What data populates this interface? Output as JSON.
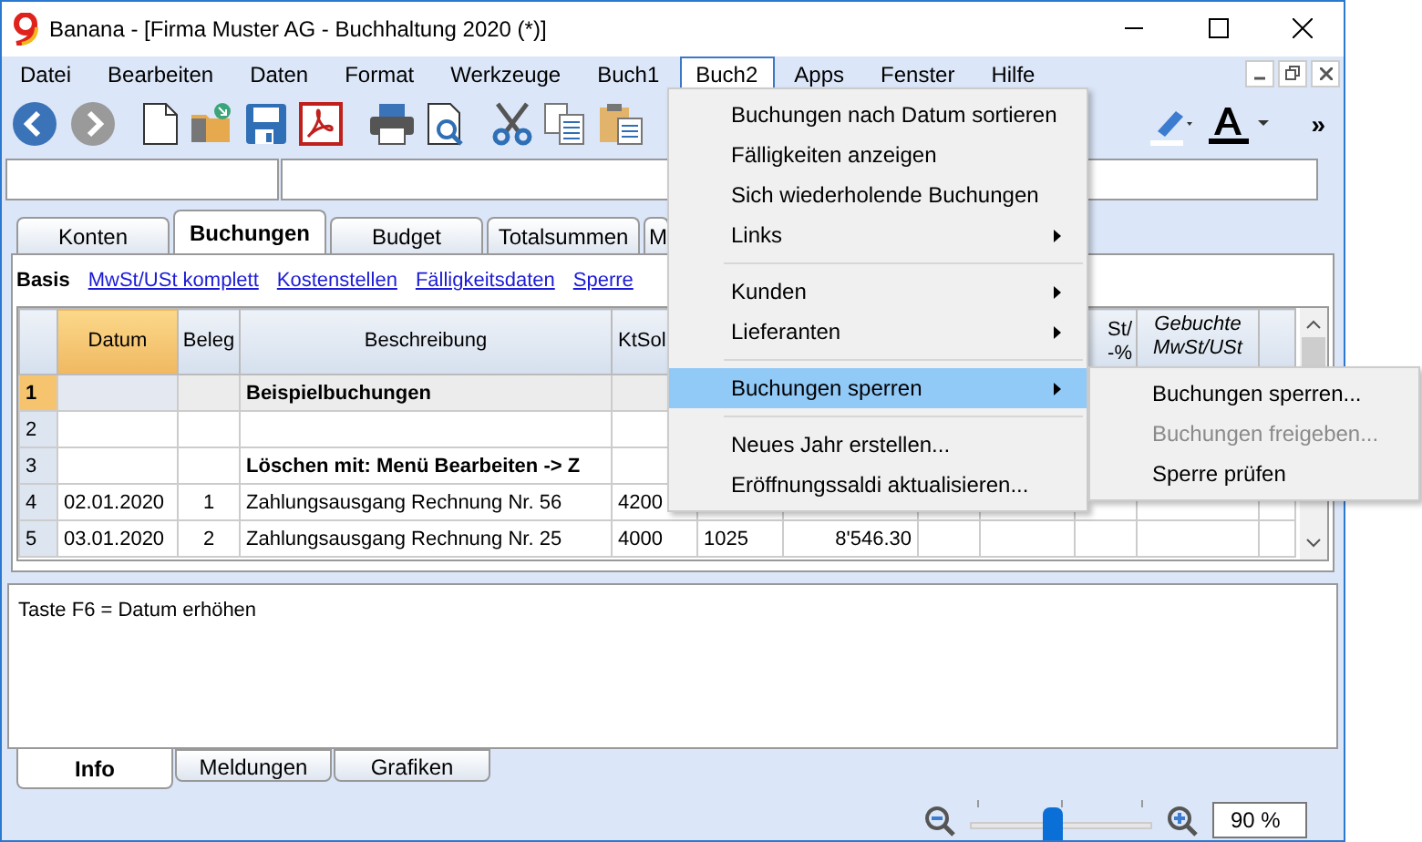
{
  "window": {
    "title": "Banana - [Firma Muster AG - Buchhaltung 2020 (*)]"
  },
  "menu_bar": [
    {
      "label": "Datei",
      "selected": false
    },
    {
      "label": "Bearbeiten",
      "selected": false
    },
    {
      "label": "Daten",
      "selected": false
    },
    {
      "label": "Format",
      "selected": false
    },
    {
      "label": "Werkzeuge",
      "selected": false
    },
    {
      "label": "Buch1",
      "selected": false
    },
    {
      "label": "Buch2",
      "selected": true
    },
    {
      "label": "Apps",
      "selected": false
    },
    {
      "label": "Fenster",
      "selected": false
    },
    {
      "label": "Hilfe",
      "selected": false
    }
  ],
  "toolbar": [
    {
      "kind": "back",
      "disabled": false
    },
    {
      "kind": "forward",
      "disabled": true
    },
    {
      "kind": "new"
    },
    {
      "kind": "open"
    },
    {
      "kind": "save"
    },
    {
      "kind": "pdf"
    },
    {
      "kind": "print"
    },
    {
      "kind": "preview"
    },
    {
      "kind": "cut"
    },
    {
      "kind": "copy"
    },
    {
      "kind": "paste"
    }
  ],
  "toolbar_overflow": "»",
  "tabs": [
    {
      "label": "Konten",
      "selected": false
    },
    {
      "label": "Buchungen",
      "selected": true
    },
    {
      "label": "Budget",
      "selected": false
    },
    {
      "label": "Totalsummen",
      "selected": false
    },
    {
      "label": "M",
      "selected": false
    }
  ],
  "views": [
    {
      "label": "Basis",
      "selected": true
    },
    {
      "label": "MwSt/USt komplett",
      "selected": false
    },
    {
      "label": "Kostenstellen",
      "selected": false
    },
    {
      "label": "Fälligkeitsdaten",
      "selected": false
    },
    {
      "label": "Sperre",
      "selected": false
    }
  ],
  "table": {
    "columns": [
      {
        "selected": false
      },
      {
        "label": "Datum",
        "selected": true
      },
      {
        "label": "Beleg",
        "selected": false
      },
      {
        "label": "Beschreibung",
        "selected": false
      },
      {
        "label": "KtSol",
        "selected": false
      },
      {
        "label": "St/ -%",
        "selected": false
      },
      {
        "label": "Gebuchte MwSt/USt",
        "selected": false
      },
      {
        "selected": false
      }
    ],
    "rows": [
      {
        "selected": true,
        "bold": true,
        "cells": [
          "1",
          "",
          "",
          "Beispielbuchungen",
          "",
          "",
          "",
          "",
          "",
          "",
          "",
          ""
        ]
      },
      {
        "selected": false,
        "cells": [
          "2",
          "",
          "",
          "",
          "",
          "",
          "",
          "",
          "",
          "",
          "",
          ""
        ]
      },
      {
        "selected": false,
        "bold": true,
        "cells": [
          "3",
          "",
          "",
          "Löschen mit: Menü Bearbeiten -> Z",
          "",
          "",
          "",
          "",
          "",
          "",
          "",
          ""
        ]
      },
      {
        "selected": false,
        "bold": false,
        "cells": [
          "4",
          "02.01.2020",
          "1",
          "Zahlungsausgang Rechnung Nr. 56",
          "4200",
          "",
          "",
          "",
          "",
          "",
          "",
          ""
        ]
      },
      {
        "selected": false,
        "bold": false,
        "cells": [
          "5",
          "03.01.2020",
          "2",
          "Zahlungsausgang Rechnung Nr. 25",
          "4000",
          "1025",
          "8'546.30",
          "",
          "",
          "",
          "",
          ""
        ]
      }
    ]
  },
  "info_text": "Taste F6 = Datum erhöhen",
  "bottom_tabs": [
    {
      "label": "Info",
      "selected": true
    },
    {
      "label": "Meldungen",
      "selected": false
    },
    {
      "label": "Grafiken",
      "selected": false
    }
  ],
  "zoom": {
    "level": 0.45,
    "value": "90 %"
  },
  "dropdown": [
    {
      "kind": "item",
      "label": "Buchungen nach Datum sortieren",
      "submenu": false,
      "selected": false
    },
    {
      "kind": "item",
      "label": "Fälligkeiten anzeigen",
      "submenu": false,
      "selected": false
    },
    {
      "kind": "item",
      "label": "Sich wiederholende Buchungen",
      "submenu": false,
      "selected": false
    },
    {
      "kind": "item",
      "label": "Links",
      "submenu": true,
      "selected": false
    },
    {
      "kind": "separator"
    },
    {
      "kind": "item",
      "label": "Kunden",
      "submenu": true,
      "selected": false
    },
    {
      "kind": "item",
      "label": "Lieferanten",
      "submenu": true,
      "selected": false
    },
    {
      "kind": "separator"
    },
    {
      "kind": "item",
      "label": "Buchungen sperren",
      "submenu": true,
      "selected": true
    },
    {
      "kind": "separator"
    },
    {
      "kind": "item",
      "label": "Neues Jahr erstellen...",
      "submenu": false,
      "selected": false
    },
    {
      "kind": "item",
      "label": "Eröffnungssaldi aktualisieren...",
      "submenu": false,
      "selected": false
    }
  ],
  "submenu": [
    {
      "label": "Buchungen sperren...",
      "disabled": false
    },
    {
      "label": "Buchungen freigeben...",
      "disabled": true
    },
    {
      "label": "Sperre prüfen",
      "disabled": false
    }
  ]
}
